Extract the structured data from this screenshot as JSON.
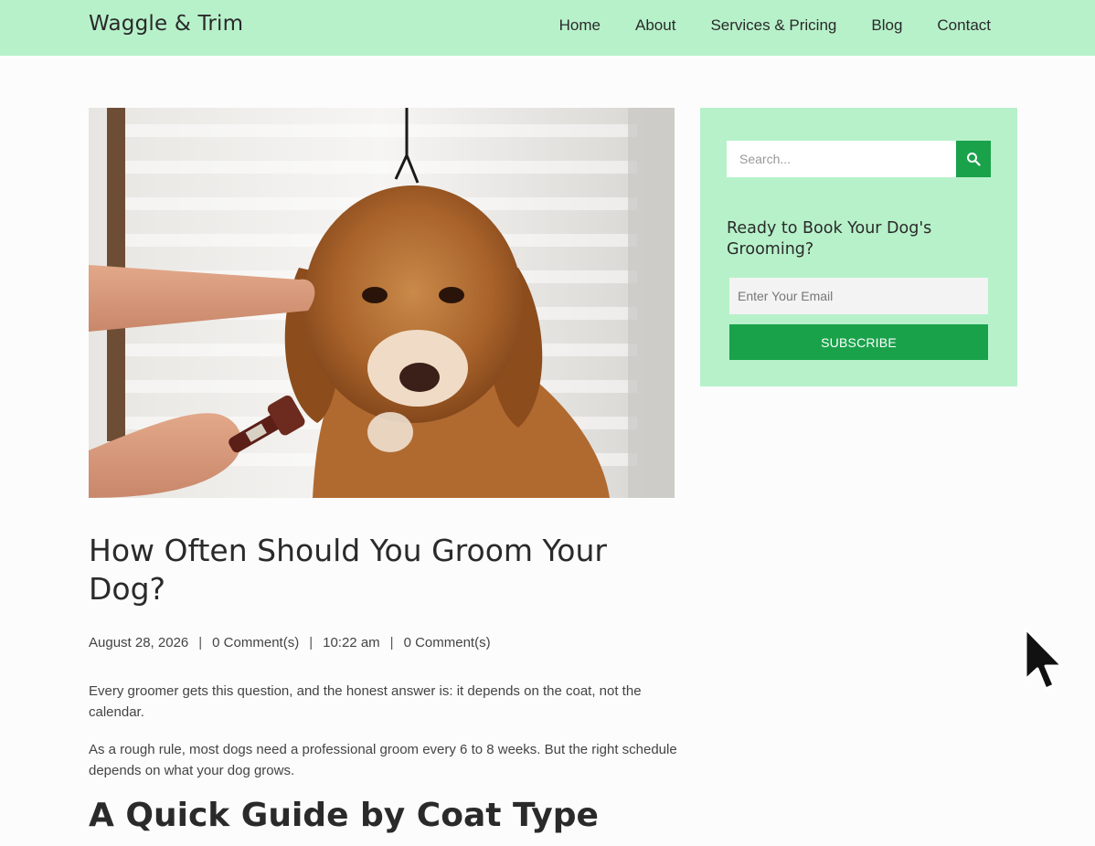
{
  "header": {
    "logo": "Waggle & Trim",
    "nav": [
      "Home",
      "About",
      "Services & Pricing",
      "Blog",
      "Contact"
    ]
  },
  "post": {
    "title": "How Often Should You Groom Your Dog?",
    "meta": {
      "date": "August 28, 2026",
      "comments_1": "0 Comment(s)",
      "time": "10:22 am",
      "comments_2": "0 Comment(s)",
      "separator": "|"
    },
    "paragraphs": [
      "Every groomer gets this question, and the honest answer is: it depends on the coat, not the calendar.",
      "As a rough rule, most dogs need a professional groom every 6 to 8 weeks. But the right schedule depends on what your dog grows."
    ],
    "section_heading": "A Quick Guide by Coat Type"
  },
  "sidebar": {
    "search_placeholder": "Search...",
    "book_heading": "Ready to Book Your Dog's Grooming?",
    "email_placeholder": "Enter Your Email",
    "subscribe_label": "SUBSCRIBE"
  },
  "colors": {
    "brand_light": "#b7f1ca",
    "accent_green": "#1aa24b"
  },
  "icons": {
    "search": "magnifier-icon",
    "cursor": "mouse-pointer-icon"
  }
}
